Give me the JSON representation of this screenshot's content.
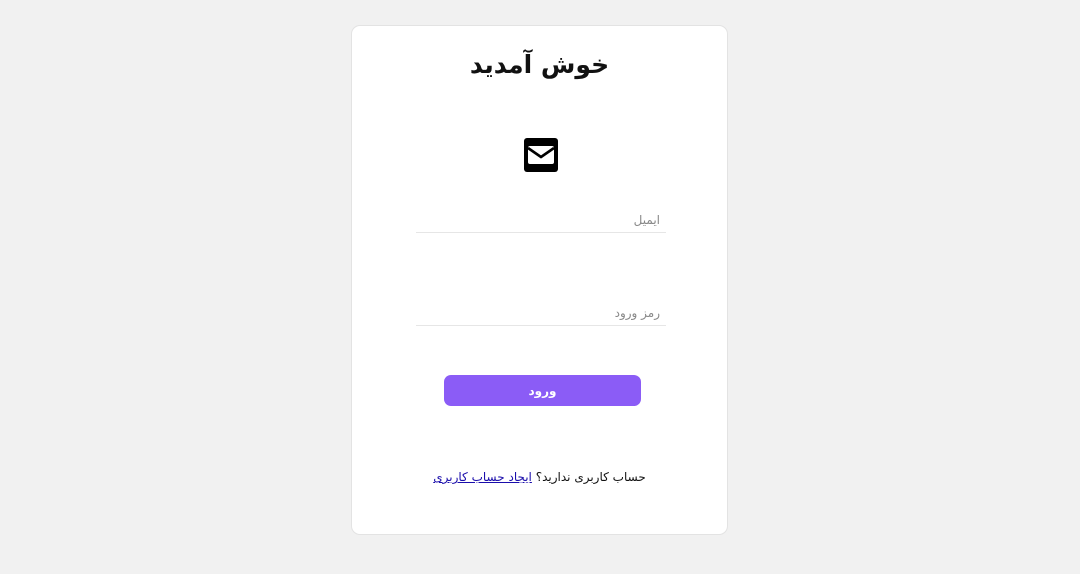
{
  "login": {
    "title": "خوش آمدید",
    "icon": "envelope-icon",
    "email": {
      "placeholder": "ایمیل",
      "value": ""
    },
    "password": {
      "placeholder": "رمز ورود",
      "value": ""
    },
    "submit_label": "ورود",
    "signup_prompt": "حساب کاربری ندارید؟",
    "signup_link": "ایجاد حساب کاربری"
  },
  "colors": {
    "page_background": "#f1f1f1",
    "card_background": "#ffffff",
    "accent": "#8b5cf6",
    "link": "#1a0dab"
  }
}
